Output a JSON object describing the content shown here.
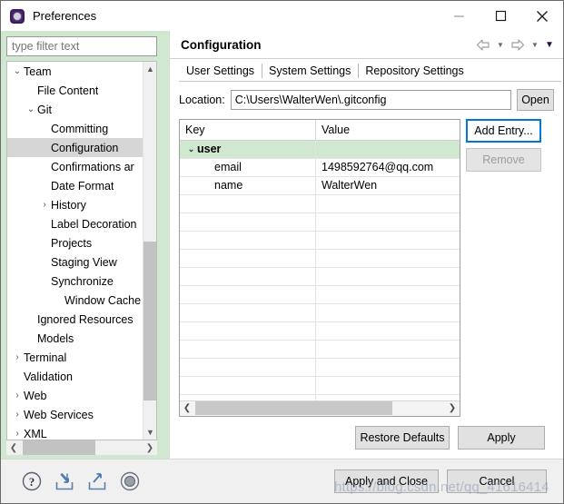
{
  "window": {
    "title": "Preferences",
    "icon": "preferences-gear-icon",
    "controls": {
      "minimize": "–",
      "maximize": "□",
      "close": "✕"
    }
  },
  "filter": {
    "placeholder": "type filter text",
    "value": ""
  },
  "tree": {
    "items": [
      {
        "label": "Team",
        "indent": 0,
        "arrow": "expanded",
        "selected": false
      },
      {
        "label": "File Content",
        "indent": 1,
        "arrow": "none",
        "selected": false
      },
      {
        "label": "Git",
        "indent": 1,
        "arrow": "expanded",
        "selected": false
      },
      {
        "label": "Committing",
        "indent": 2,
        "arrow": "none",
        "selected": false
      },
      {
        "label": "Configuration",
        "indent": 2,
        "arrow": "none",
        "selected": true
      },
      {
        "label": "Confirmations ar",
        "indent": 2,
        "arrow": "none",
        "selected": false
      },
      {
        "label": "Date Format",
        "indent": 2,
        "arrow": "none",
        "selected": false
      },
      {
        "label": "History",
        "indent": 2,
        "arrow": "collapsed",
        "selected": false
      },
      {
        "label": "Label Decoration",
        "indent": 2,
        "arrow": "none",
        "selected": false
      },
      {
        "label": "Projects",
        "indent": 2,
        "arrow": "none",
        "selected": false
      },
      {
        "label": "Staging View",
        "indent": 2,
        "arrow": "none",
        "selected": false
      },
      {
        "label": "Synchronize",
        "indent": 2,
        "arrow": "none",
        "selected": false
      },
      {
        "label": "Window Cache",
        "indent": 3,
        "arrow": "none",
        "selected": false
      },
      {
        "label": "Ignored Resources",
        "indent": 1,
        "arrow": "none",
        "selected": false
      },
      {
        "label": "Models",
        "indent": 1,
        "arrow": "none",
        "selected": false
      },
      {
        "label": "Terminal",
        "indent": 0,
        "arrow": "collapsed",
        "selected": false
      },
      {
        "label": "Validation",
        "indent": 0,
        "arrow": "none",
        "selected": false
      },
      {
        "label": "Web",
        "indent": 0,
        "arrow": "collapsed",
        "selected": false
      },
      {
        "label": "Web Services",
        "indent": 0,
        "arrow": "collapsed",
        "selected": false
      },
      {
        "label": "XML",
        "indent": 0,
        "arrow": "collapsed",
        "selected": false
      }
    ]
  },
  "page": {
    "title": "Configuration",
    "nav": {
      "back_icon": "back-arrow-icon",
      "back_caret": "▼",
      "forward_icon": "forward-arrow-icon",
      "forward_caret": "▼",
      "menu_caret": "▼"
    }
  },
  "tabs": [
    {
      "label": "User Settings",
      "active": true
    },
    {
      "label": "System Settings",
      "active": false
    },
    {
      "label": "Repository Settings",
      "active": false
    }
  ],
  "location": {
    "label": "Location:",
    "value": "C:\\Users\\WalterWen\\.gitconfig",
    "open_label": "Open"
  },
  "table": {
    "columns": [
      "Key",
      "Value"
    ],
    "rows": [
      {
        "key": "user",
        "value": "",
        "indent": 0,
        "arrow": "expanded",
        "highlight": true
      },
      {
        "key": "email",
        "value": "1498592764@qq.com",
        "indent": 1,
        "arrow": "none",
        "highlight": false
      },
      {
        "key": "name",
        "value": "WalterWen",
        "indent": 1,
        "arrow": "none",
        "highlight": false
      }
    ],
    "empty_row_count": 12,
    "hscroll": {
      "left_arrow": "❮",
      "right_arrow": "❯"
    }
  },
  "side_buttons": {
    "add_entry": "Add Entry...",
    "remove": "Remove"
  },
  "page_buttons": {
    "restore_defaults": "Restore Defaults",
    "apply": "Apply"
  },
  "footer": {
    "icons": [
      {
        "name": "help-icon"
      },
      {
        "name": "import-icon"
      },
      {
        "name": "export-icon"
      },
      {
        "name": "record-icon"
      }
    ],
    "apply_and_close": "Apply and Close",
    "cancel": "Cancel"
  },
  "watermark": "https://blog.csdn.net/qq_41616414",
  "colors": {
    "accent": "#0078d7",
    "panel_green": "#cfe8cf",
    "selection_gray": "#d6d6d6",
    "button_face": "#e1e1e1"
  }
}
